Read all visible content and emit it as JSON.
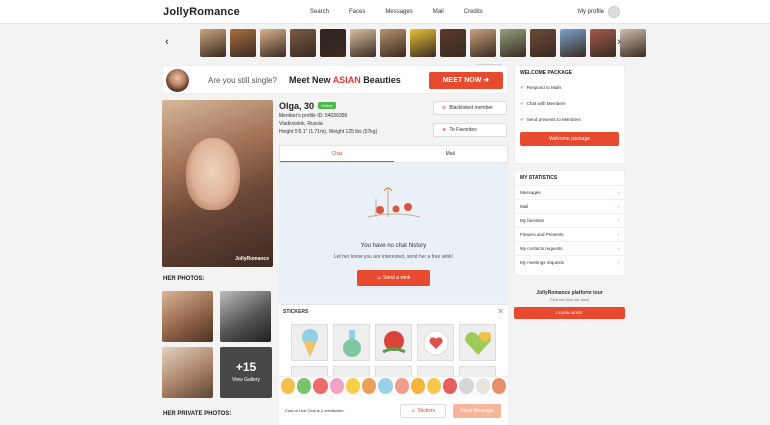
{
  "header": {
    "logo": "JollyRomance",
    "nav": [
      "Search",
      "Faces",
      "Messages",
      "Mail",
      "Credits"
    ],
    "my_profile": "My profile"
  },
  "carousel": {
    "prev": "‹",
    "next": "›",
    "thumb_colors": [
      "#c9a47e",
      "#a8703e",
      "#d8b28c",
      "#7b5a44",
      "#2f2420",
      "#d7c0a4",
      "#b6916a",
      "#e8c235",
      "#5b3a2a",
      "#c7a27d",
      "#93a07a",
      "#6b4a36",
      "#7aa3c9",
      "#a35b4a",
      "#ccc0b0"
    ]
  },
  "banner": {
    "question": "Are you still single?",
    "meet_prefix": "Meet New ",
    "meet_highlight": "ASIAN",
    "meet_suffix": " Beauties",
    "button": "MEET NOW ➔",
    "ad_label": "ADVERTISEMENT"
  },
  "profile": {
    "name": "Olga, 30",
    "online": "Online",
    "profile_id": "Member's profile ID: 54036358",
    "location": "Vladivostok, Russia",
    "height_weight": "Height 5'6.1\" (1.71m), Weight 125 lbs (57kg)",
    "watermark": "JollyRomance",
    "block_member": "Blacklisted member",
    "favorites": "To Favorites"
  },
  "photos": {
    "title": "HER PHOTOS:",
    "more_count": "+15",
    "more_label": "View Gallery",
    "private_title": "HER PRIVATE PHOTOS:"
  },
  "chat": {
    "tabs": [
      "Chat",
      "Mail"
    ],
    "empty_title": "You have no chat history",
    "empty_sub": "Let her know you are interested, send her a free wink!",
    "wink_button": "Send a wink"
  },
  "stickers": {
    "title": "STICKERS",
    "close": "✕",
    "items": [
      "ice-cream",
      "potion",
      "rose",
      "love-letter",
      "hearts"
    ],
    "strip_colors": [
      "#f4c04b",
      "#79c46b",
      "#ef6a6a",
      "#f2a3c4",
      "#f7d04a",
      "#e9a05a",
      "#9ad0ea",
      "#f29c8e",
      "#f5b43a",
      "#f6c94c",
      "#e85d5d",
      "#d6d6d6",
      "#e9e3d9",
      "#ea8f6d"
    ],
    "cost": "Cost of Live Chat is 2 credits/min.",
    "stickers_button": "Stickers",
    "send_button": "Send Message"
  },
  "welcome": {
    "title": "WELCOME PACKAGE",
    "items": [
      "Respond to Mails",
      "Chat with Members",
      "Send presents to Members"
    ],
    "button": "Welcome package"
  },
  "stats": {
    "title": "MY STATISTICS",
    "items": [
      "Messages",
      "Mail",
      "My favorites",
      "Flowers and Presents",
      "My contacts requests",
      "My meetings requests"
    ]
  },
  "tour": {
    "title": "JollyRomance platform tour",
    "sub": "Find out how we work",
    "button": "LEARN MORE"
  },
  "colors": {
    "accent": "#e74a2e",
    "online": "#4ab84a"
  }
}
